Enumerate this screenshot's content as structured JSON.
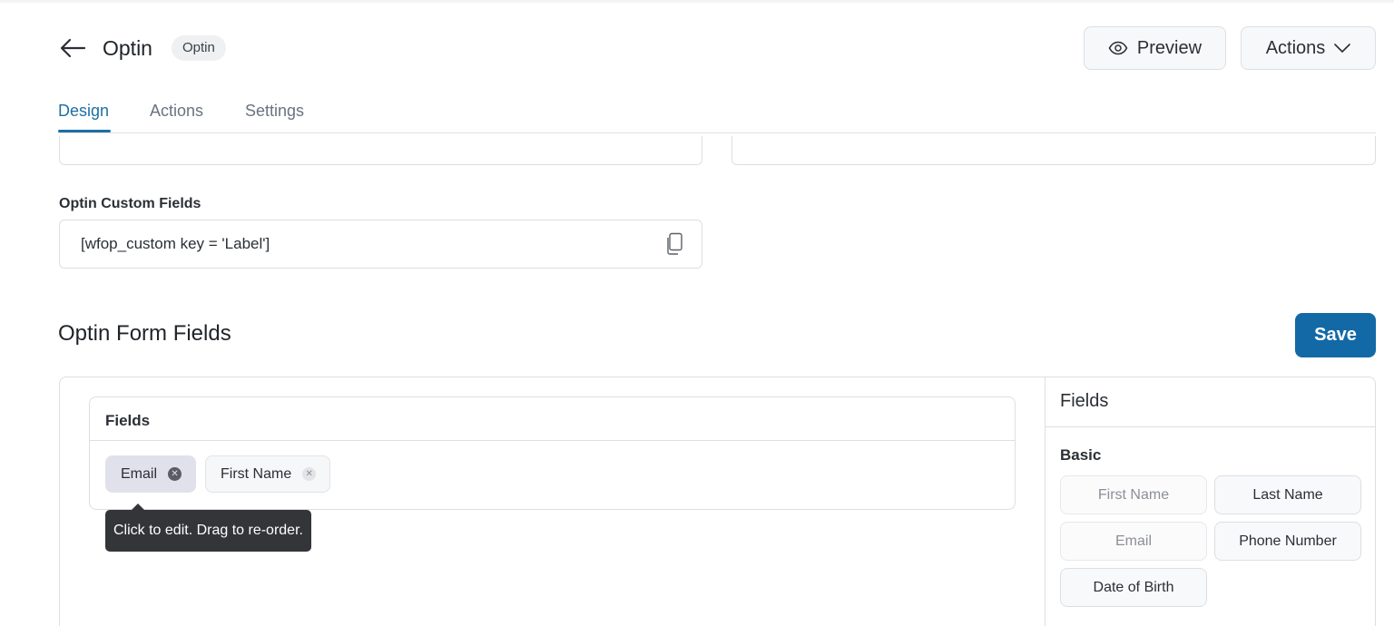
{
  "header": {
    "title": "Optin",
    "badge": "Optin",
    "preview_label": "Preview",
    "actions_label": "Actions",
    "icons": {
      "back": "arrow-left-icon",
      "preview": "eye-icon",
      "actions": "chevron-down-icon"
    }
  },
  "tabs": [
    {
      "label": "Design",
      "active": true
    },
    {
      "label": "Actions",
      "active": false
    },
    {
      "label": "Settings",
      "active": false
    }
  ],
  "custom_fields": {
    "label": "Optin Custom Fields",
    "value": "[wfop_custom key = 'Label']"
  },
  "form_fields": {
    "title": "Optin Form Fields",
    "save_label": "Save",
    "fields_box_title": "Fields",
    "chips": [
      {
        "label": "Email",
        "selected": true
      },
      {
        "label": "First Name",
        "selected": false
      }
    ],
    "tooltip": "Click to edit. Drag to re-order."
  },
  "sidebar": {
    "title": "Fields",
    "group_label": "Basic",
    "items": [
      {
        "label": "First Name",
        "enabled": false
      },
      {
        "label": "Last Name",
        "enabled": true
      },
      {
        "label": "Email",
        "enabled": false
      },
      {
        "label": "Phone Number",
        "enabled": true
      },
      {
        "label": "Date of Birth",
        "enabled": true
      }
    ]
  },
  "colors": {
    "accent": "#1d6fa5",
    "save_button": "#1269a6",
    "tooltip_bg": "#333538"
  }
}
